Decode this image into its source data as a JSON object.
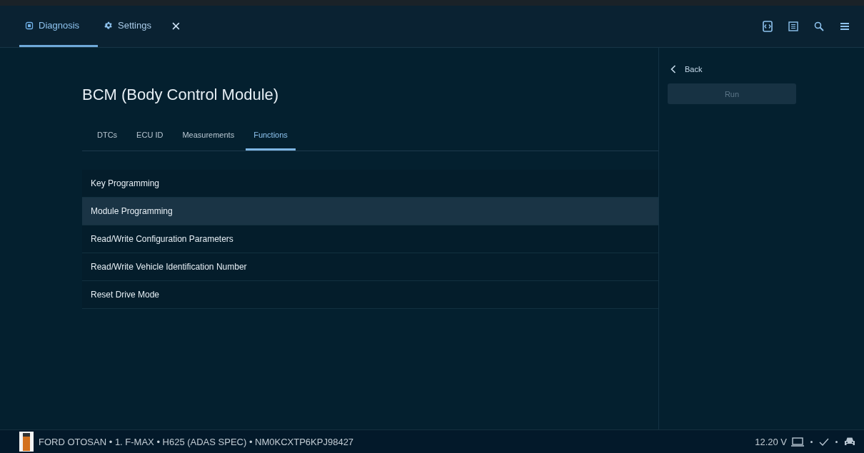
{
  "header": {
    "tabs": [
      {
        "label": "Diagnosis",
        "kind": "chip",
        "selected": true
      },
      {
        "label": "Settings",
        "kind": "gear",
        "selected": false
      }
    ],
    "close": "×"
  },
  "module": {
    "title": "BCM (Body Control Module)",
    "tabs": [
      {
        "label": "DTCs",
        "selected": false
      },
      {
        "label": "ECU ID",
        "selected": false
      },
      {
        "label": "Measurements",
        "selected": false
      },
      {
        "label": "Functions",
        "selected": true
      }
    ],
    "functions": [
      {
        "label": "Key Programming",
        "selected": false
      },
      {
        "label": "Module Programming",
        "selected": true
      },
      {
        "label": "Read/Write Configuration Parameters",
        "selected": false
      },
      {
        "label": "Read/Write Vehicle Identification Number",
        "selected": false
      },
      {
        "label": "Reset Drive Mode",
        "selected": false
      }
    ]
  },
  "side_panel": {
    "back": "Back",
    "run": {
      "label": "Run",
      "disabled": true
    }
  },
  "status_bar": {
    "vehicle": "FORD OTOSAN • 1. F-MAX • H625 (ADAS SPEC) • NM0KCXTP6KPJ98427",
    "voltage": "12.20 V",
    "connection_ok": true
  }
}
